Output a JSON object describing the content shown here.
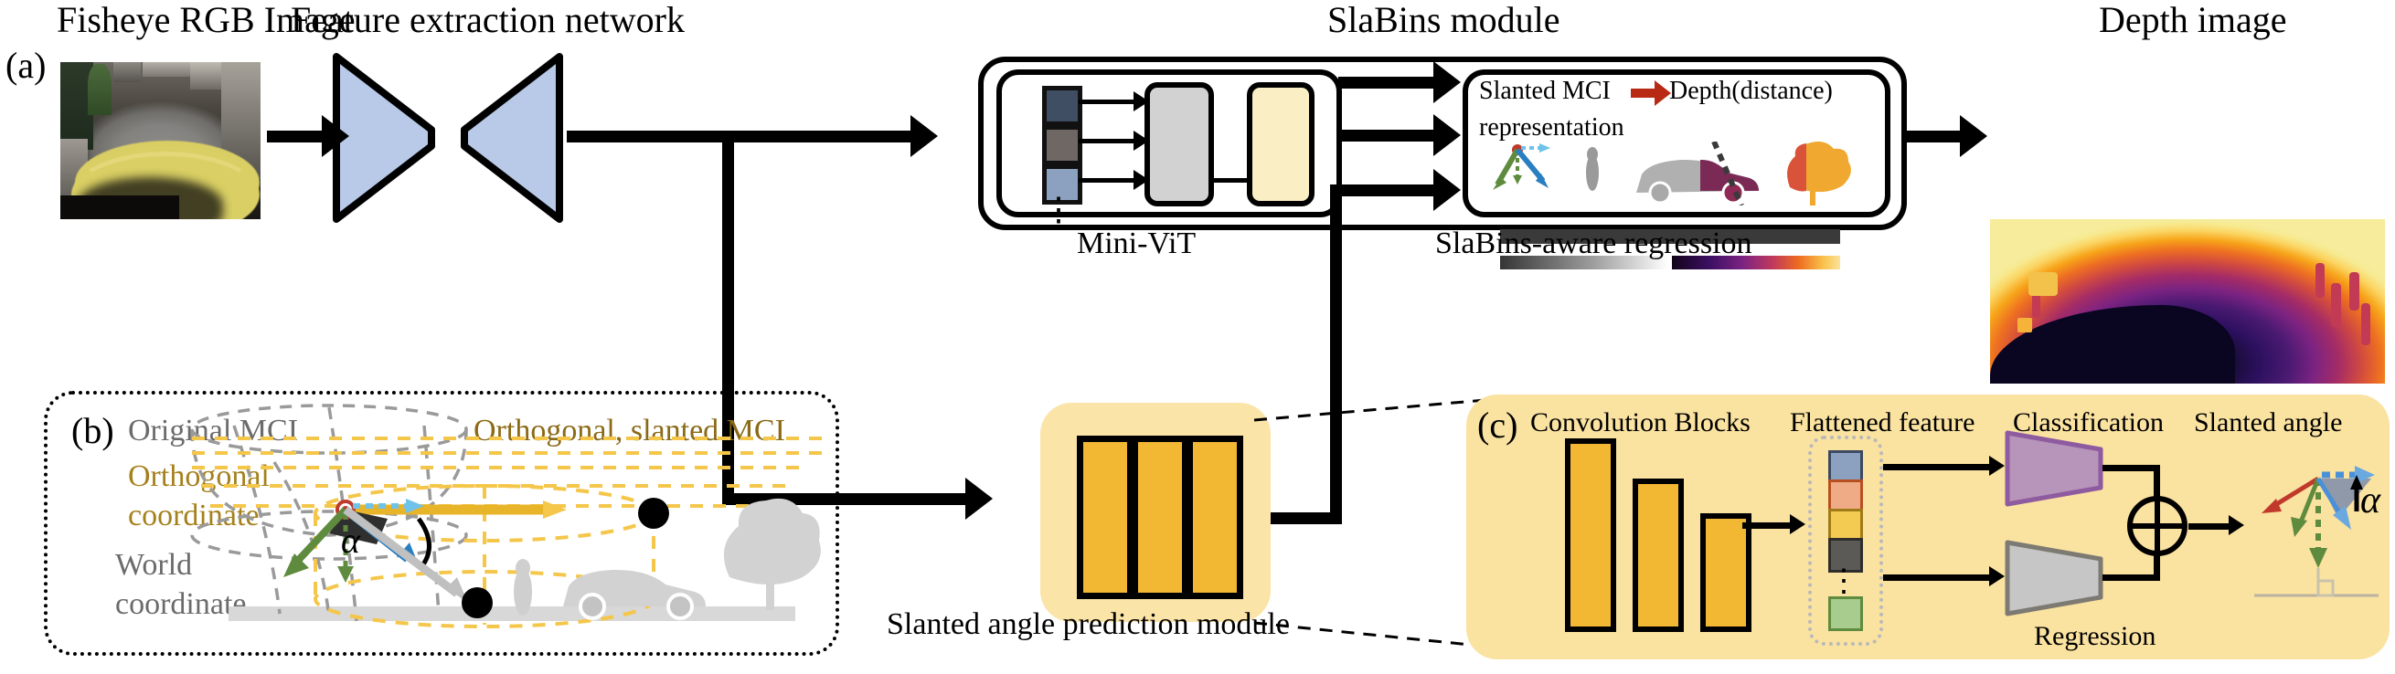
{
  "figure": {
    "panel_a_letter": "(a)",
    "panel_b_letter": "(b)",
    "panel_c_letter": "(c)"
  },
  "titles": {
    "fisheye": "Fisheye RGB Image",
    "feature_extraction": "Feature extraction network",
    "slabins_module": "SlaBins module",
    "depth_image": "Depth image"
  },
  "slabins": {
    "mini_vit_label": "Mini-ViT",
    "regression_label": "SlaBins-aware regression",
    "slanted_mci": "Slanted MCI",
    "depth_distance": "Depth(distance)",
    "representation": "representation",
    "vertical_dots": "⋮"
  },
  "panel_b": {
    "original_mci": "Original MCI",
    "orthogonal_slanted_mci": "Orthogonal, slanted MCI",
    "orthogonal_coordinate_l1": "Orthogonal",
    "orthogonal_coordinate_l2": "coordinate",
    "world_coordinate_l1": "World",
    "world_coordinate_l2": "coordinate",
    "alpha": "α"
  },
  "panel_c": {
    "convolution_blocks": "Convolution Blocks",
    "flattened_feature": "Flattened feature",
    "classification": "Classification",
    "regression": "Regression",
    "slanted_angle": "Slanted angle",
    "alpha": "α",
    "plus": "⊕",
    "vertical_dots": "⋮"
  },
  "slanted_angle_module": {
    "label": "Slanted angle prediction module"
  },
  "colors": {
    "encoder_blue": "#b9c9e8",
    "token_dark_navy": "#3f4e63",
    "token_gray": "#6e6763",
    "token_blue": "#8ca0c0",
    "token_slate": "#5f6b83",
    "mini_vit_gray": "#d2d2d2",
    "mini_vit_cream": "#faeec4",
    "slanted_module_bg": "#fbe4a7",
    "panel_c_bg": "#fae2a0",
    "conv_bar": "#f2b733",
    "classification_purple": "#b794b9",
    "classification_purple_border": "#8e5aa0",
    "regression_gray": "#c6c6c6",
    "feature_blue": "#8ca0c0",
    "feature_salmon": "#eeab85",
    "feature_yellow": "#f3cb52",
    "feature_darkgray": "#5c5a57",
    "feature_green": "#a7cc8e",
    "red_arrow": "#b82a14",
    "gold": "#c79a20",
    "gold_dash": "#f4c64a",
    "gray_dash": "#9a9a9a",
    "world_green": "#5f8b3e",
    "ortho_blue": "#2a7fc1",
    "cyan_dash": "#6fc2ea",
    "text_gray": "#6b6b6b"
  },
  "colorbars": {
    "road_bar": "solid dark gray bar",
    "gray_gradient": [
      "#3a3a3a",
      "#ffffff"
    ],
    "magma_gradient": [
      "#120418",
      "#3b0f62",
      "#7b2382",
      "#c0395c",
      "#ee6a21",
      "#f8c24a",
      "#fbe39c"
    ]
  }
}
